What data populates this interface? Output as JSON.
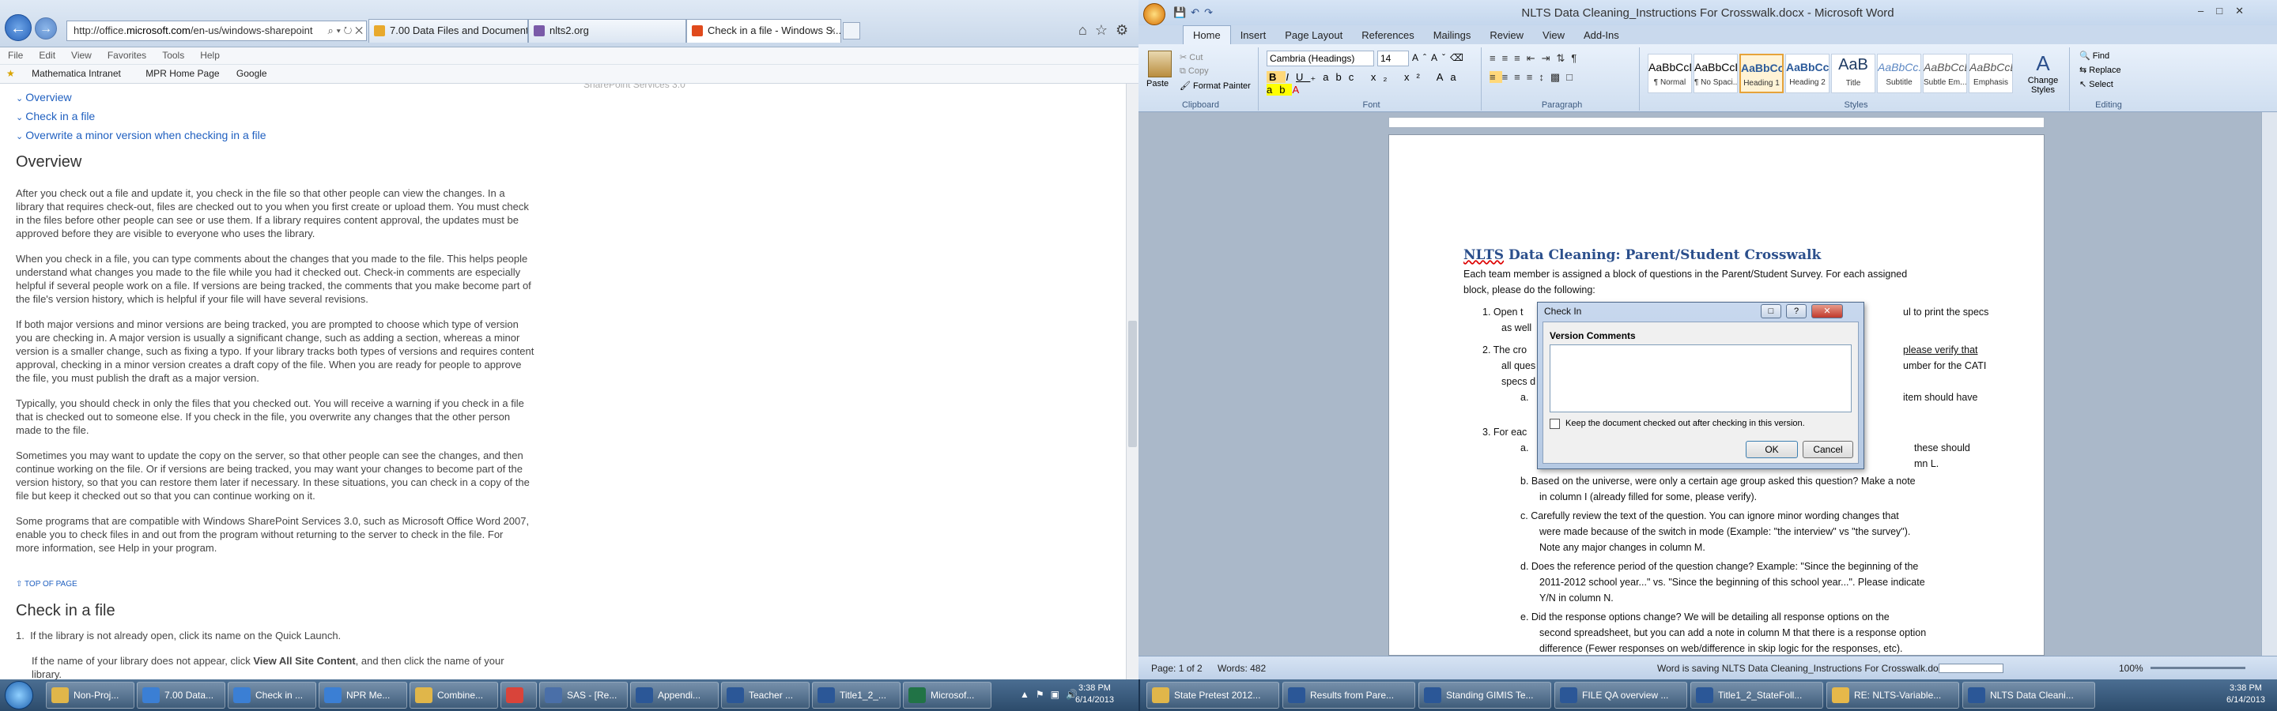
{
  "ie": {
    "address_prefix": "http://office.",
    "address_domain": "microsoft.com",
    "address_suffix": "/en-us/windows-sharepoint",
    "tabs": [
      {
        "label": "7.00 Data Files and Documenta...",
        "icon_color": "#e8a92c"
      },
      {
        "label": "nlts2.org",
        "icon_color": "#7a5aa8"
      },
      {
        "label": "Check in a file - Windows S...",
        "icon_color": "#e04a1c"
      }
    ],
    "menu": [
      "File",
      "Edit",
      "View",
      "Favorites",
      "Tools",
      "Help"
    ],
    "favorites": [
      "Mathematica Intranet",
      "MPR Home Page",
      "Google"
    ],
    "page": {
      "toc": [
        "Overview",
        "Check in a file",
        "Overwrite a minor version when checking in a file"
      ],
      "faded_caption": "SharePoint Services 3.0",
      "overview_heading": "Overview",
      "paragraphs": [
        [
          "After you check out a file and update it, you check in the file so that other people can view the changes. In a",
          "library that requires check-out, files are checked out to you when you first create or upload them. You must check",
          "in the files before other people can see or use them. If a library requires content approval, the updates must be",
          "approved before they are visible to everyone who uses the library."
        ],
        [
          "When you check in a file, you can type comments about the changes that you made to the file. This helps people",
          "understand what changes you made to the file while you had it checked out. Check-in comments are especially",
          "helpful if several people work on a file. If versions are being tracked, the comments that you make become part of",
          "the file's version history, which is helpful if your file will have several revisions."
        ],
        [
          "If both major versions and minor versions are being tracked, you are prompted to choose which type of version",
          "you are checking in. A major version is usually a significant change, such as adding a section, whereas a minor",
          "version is a smaller change, such as fixing a typo. If your library tracks both types of versions and requires content",
          "approval, checking in a minor version creates a draft copy of the file. When you are ready for people to approve",
          "the file, you must publish the draft as a major version."
        ],
        [
          "Typically, you should check in only the files that you checked out. You will receive a warning if you check in a file",
          "that is checked out to someone else. If you check in the file, you overwrite any changes that the other person",
          "made to the file."
        ],
        [
          "Sometimes you may want to update the copy on the server, so that other people can see the changes, and then",
          "continue working on the file. Or if versions are being tracked, you may want your changes to become part of the",
          "version history, so that you can restore them later if necessary. In these situations, you can check in a copy of the",
          "file but keep it checked out so that you can continue working on it."
        ],
        [
          "Some programs that are compatible with Windows SharePoint Services 3.0, such as Microsoft Office Word 2007,",
          "enable you to check files in and out from the program without returning to the server to check in the file. For",
          "more information, see Help in your program."
        ]
      ],
      "top_link": "TOP OF PAGE",
      "checkin_heading": "Check in a file",
      "step1": "If the library is not already open, click its name on the Quick Launch.",
      "step1_sub_a": "If the name of your library does not appear, click ",
      "step1_sub_bold": "View All Site Content",
      "step1_sub_b": ", and then click the name of your",
      "step1_sub_c": "library."
    }
  },
  "word": {
    "title": "NLTS Data Cleaning_Instructions For Crosswalk.docx - Microsoft Word",
    "tabs": [
      "Home",
      "Insert",
      "Page Layout",
      "References",
      "Mailings",
      "Review",
      "View",
      "Add-Ins"
    ],
    "clipboard": {
      "paste": "Paste",
      "cut": "Cut",
      "copy": "Copy",
      "format_painter": "Format Painter",
      "label": "Clipboard"
    },
    "font": {
      "name": "Cambria (Headings)",
      "size": "14",
      "label": "Font"
    },
    "paragraph_label": "Paragraph",
    "styles": [
      {
        "sample": "AaBbCcDc",
        "name": "¶ Normal"
      },
      {
        "sample": "AaBbCcDc",
        "name": "¶ No Spaci..."
      },
      {
        "sample": "AaBbCo",
        "name": "Heading 1"
      },
      {
        "sample": "AaBbCc",
        "name": "Heading 2"
      },
      {
        "sample": "AaB",
        "name": "Title"
      },
      {
        "sample": "AaBbCc.",
        "name": "Subtitle"
      },
      {
        "sample": "AaBbCcDi",
        "name": "Subtle Em..."
      },
      {
        "sample": "AaBbCcDi",
        "name": "Emphasis"
      }
    ],
    "styles_label": "Styles",
    "change_styles": "Change Styles",
    "editing": {
      "find": "Find",
      "replace": "Replace",
      "select": "Select",
      "label": "Editing"
    },
    "document": {
      "title_prefix": "NLTS",
      "title_rest": " Data Cleaning: Parent/Student Crosswalk",
      "intro1": "Each team member is assigned a block of questions in the Parent/Student Survey. For each assigned",
      "intro2": "block, please do the following:",
      "l1a": "1.   Open t",
      "l1b": "ul to print the specs",
      "l1c": "as well",
      "l2a": "2.   The cro",
      "l2b": "please verify that",
      "l2c": "all ques",
      "l2d": "umber for the CATI",
      "l2e": "specs d",
      "l2f": "a.",
      "l2g": "item should have",
      "l3a": "3.   For eac",
      "l3b": "a.",
      "l3c": "these should",
      "l3d": "mn L.",
      "b": "b.   Based on the universe, were only a certain age group asked this question? Make a note",
      "b2": "in column I (already filled for some, please verify).",
      "c": "c.   Carefully review the text of the question. You can ignore minor wording changes that",
      "c2": "were made because of the switch in mode (Example: \"the interview\" vs \"the survey\").",
      "c3": "Note any major changes in column M.",
      "d": "d.   Does the reference period of the question change? Example: \"Since the beginning of the",
      "d2": "2011-2012 school year...\" vs. \"Since the beginning of this school year...\". Please indicate",
      "d3": "Y/N in column N.",
      "e": "e.   Did the response options change? We will be detailing all response options on the",
      "e2": "second spreadsheet, but you can add a note in column M that there is a response option",
      "e3": "difference (Fewer responses on web/difference in skip logic for the responses, etc)."
    },
    "status": {
      "page": "Page: 1 of 2",
      "words": "Words: 482",
      "saving": "Word is saving NLTS Data Cleaning_Instructions For Crosswalk.docx",
      "zoom": "100%"
    },
    "dialog": {
      "title": "Check In",
      "label": "Version Comments",
      "value": "",
      "keep_label": "Keep the document checked out after checking in this version.",
      "ok": "OK",
      "cancel": "Cancel"
    }
  },
  "taskbar": {
    "left_tasks": [
      {
        "label": "Non-Proj...",
        "color": "#e0b64a"
      },
      {
        "label": "7.00 Data...",
        "color": "#3b7fd4"
      },
      {
        "label": "Check in ...",
        "color": "#3b7fd4"
      },
      {
        "label": "NPR Me...",
        "color": "#3b7fd4"
      },
      {
        "label": "Combine...",
        "color": "#e0b64a"
      },
      {
        "label": "",
        "color": "#d9443a"
      },
      {
        "label": "SAS - [Re...",
        "color": "#4a6fa8"
      },
      {
        "label": "Appendi...",
        "color": "#2b5797"
      },
      {
        "label": "Teacher ...",
        "color": "#2b5797"
      },
      {
        "label": "Title1_2_...",
        "color": "#2b5797"
      },
      {
        "label": "Microsof...",
        "color": "#217346"
      }
    ],
    "left_clock": {
      "time": "3:38 PM",
      "date": "6/14/2013"
    },
    "right_tasks": [
      {
        "label": "State Pretest 2012...",
        "color": "#e0b64a"
      },
      {
        "label": "Results from Pare...",
        "color": "#2b5797"
      },
      {
        "label": "Standing GIMIS Te...",
        "color": "#2b5797"
      },
      {
        "label": "FILE QA overview ...",
        "color": "#2b5797"
      },
      {
        "label": "Title1_2_StateFoll...",
        "color": "#2b5797"
      },
      {
        "label": "RE: NLTS-Variable...",
        "color": "#e6b84a"
      },
      {
        "label": "NLTS Data Cleani...",
        "color": "#2b5797"
      }
    ],
    "right_clock": {
      "time": "3:38 PM",
      "date": "6/14/2013"
    }
  }
}
